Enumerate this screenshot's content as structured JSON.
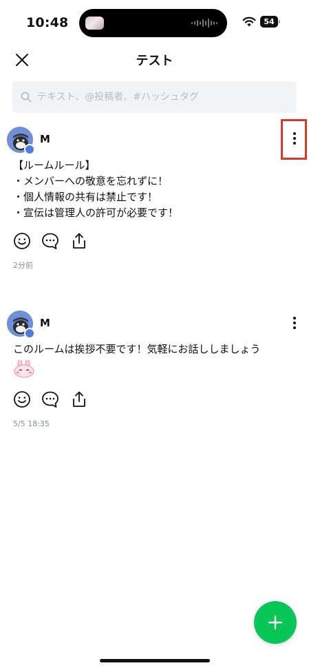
{
  "status_bar": {
    "time": "10:48",
    "battery": "54"
  },
  "header": {
    "title": "テスト"
  },
  "search": {
    "placeholder": "テキスト、@投稿者、#ハッシュタグ"
  },
  "posts": [
    {
      "author": "M",
      "body": "【ルームルール】\n・メンバーへの敬意を忘れずに！\n・個人情報の共有は禁止です！\n・宣伝は管理人の許可が必要です！",
      "time": "2分前"
    },
    {
      "author": "M",
      "body": "このルームは挨拶不要です！気軽にお話ししましょう",
      "time": "5/5 18:35"
    }
  ],
  "icons": {
    "close": "close-icon",
    "search": "search-icon",
    "more": "more-vertical-icon",
    "react": "smiley-icon",
    "comment": "speech-bubble-icon",
    "share": "share-icon",
    "add": "plus-icon"
  },
  "colors": {
    "accent": "#06c755",
    "highlight": "#d9392d",
    "avatar": "#6f8fd9"
  }
}
